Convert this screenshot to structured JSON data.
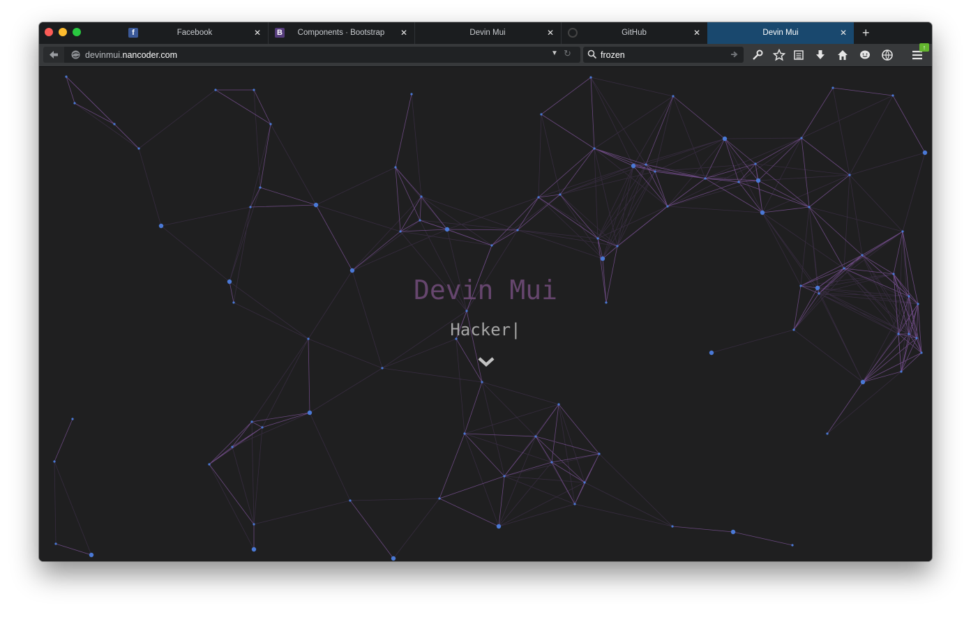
{
  "browser": {
    "tabs": [
      {
        "label": "Facebook",
        "favicon": "facebook-icon",
        "active": false
      },
      {
        "label": "Components · Bootstrap",
        "favicon": "bootstrap-icon",
        "active": false
      },
      {
        "label": "Devin Mui",
        "favicon": "",
        "active": false
      },
      {
        "label": "GitHub",
        "favicon": "github-icon",
        "active": false
      },
      {
        "label": "Devin Mui",
        "favicon": "",
        "active": true
      }
    ],
    "url_prefix": "devinmui.",
    "url_host": "nancoder.com",
    "search_query": "frozen",
    "accent": "#19486e"
  },
  "hero": {
    "name": "Devin Mui",
    "role": "Hacker|",
    "name_color": "#66466e",
    "line_color": "#a96bd0",
    "node_color": "#4a79d6"
  }
}
